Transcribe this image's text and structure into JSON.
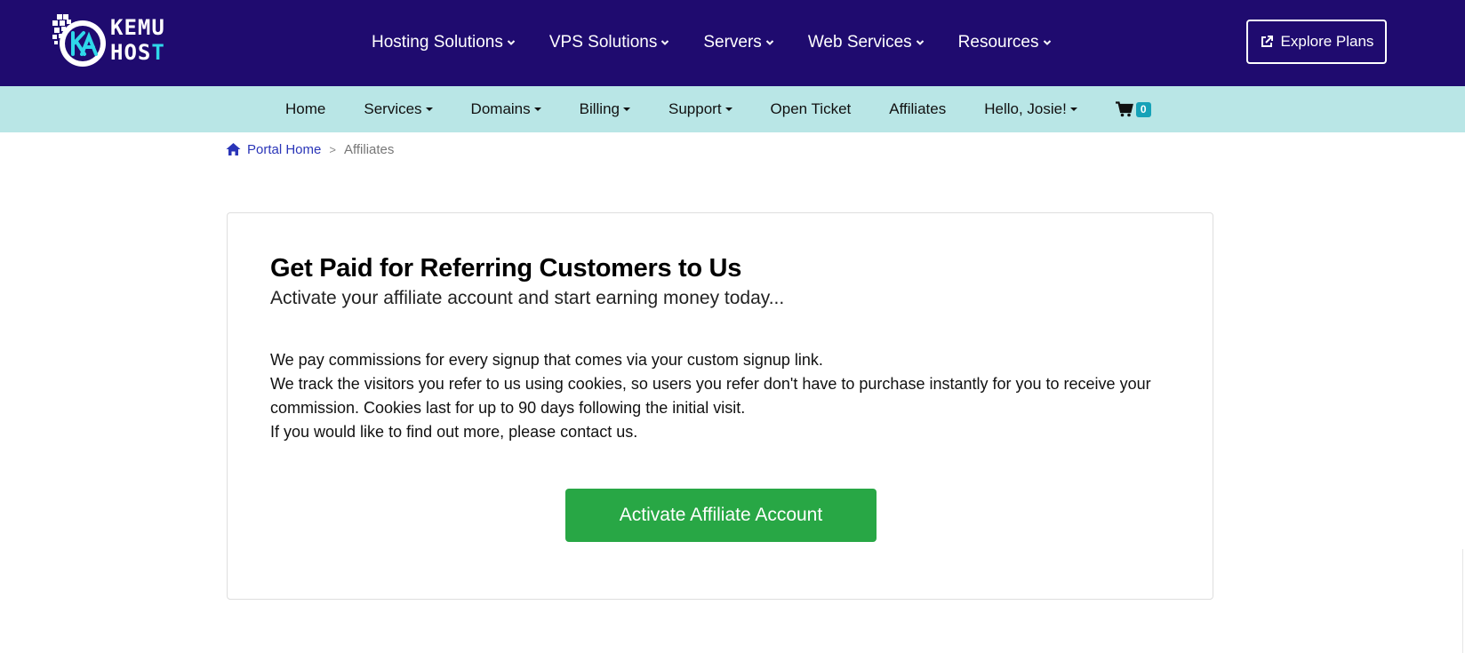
{
  "brand": {
    "line1": "KEMU",
    "line2_main": "HOS",
    "line2_accent": "T",
    "logo_icon": "kh-monogram-icon",
    "colors": {
      "header_bg": "#1f0b6f",
      "accent": "#2fd8ea"
    }
  },
  "main_nav": {
    "items": [
      {
        "label": "Hosting Solutions",
        "icon": "chevron-down-icon"
      },
      {
        "label": "VPS Solutions",
        "icon": "chevron-down-icon"
      },
      {
        "label": "Servers",
        "icon": "chevron-down-icon"
      },
      {
        "label": "Web Services",
        "icon": "chevron-down-icon"
      },
      {
        "label": "Resources",
        "icon": "chevron-down-icon"
      }
    ],
    "cta": {
      "label": "Explore Plans",
      "icon": "external-link-icon"
    }
  },
  "sub_nav": {
    "bg_color": "#b9e6e6",
    "items": [
      {
        "label": "Home",
        "dropdown": false
      },
      {
        "label": "Services",
        "dropdown": true
      },
      {
        "label": "Domains",
        "dropdown": true
      },
      {
        "label": "Billing",
        "dropdown": true
      },
      {
        "label": "Support",
        "dropdown": true
      },
      {
        "label": "Open Ticket",
        "dropdown": false
      },
      {
        "label": "Affiliates",
        "dropdown": false
      },
      {
        "label": "Hello, Josie!",
        "dropdown": true
      }
    ],
    "cart": {
      "icon": "shopping-cart-icon",
      "count": "0",
      "badge_color": "#17a2b8"
    }
  },
  "breadcrumb": {
    "icon": "home-icon",
    "home_label": "Portal Home",
    "separator": ">",
    "current": "Affiliates"
  },
  "affiliate_card": {
    "title": "Get Paid for Referring Customers to Us",
    "subtitle": "Activate your affiliate account and start earning money today...",
    "paragraphs": [
      "We pay commissions for every signup that comes via your custom signup link.",
      "We track the visitors you refer to us using cookies, so users you refer don't have to purchase instantly for you to receive your commission. Cookies last for up to 90 days following the initial visit.",
      "If you would like to find out more, please contact us."
    ],
    "button_label": "Activate Affiliate Account",
    "button_color": "#28a745"
  }
}
